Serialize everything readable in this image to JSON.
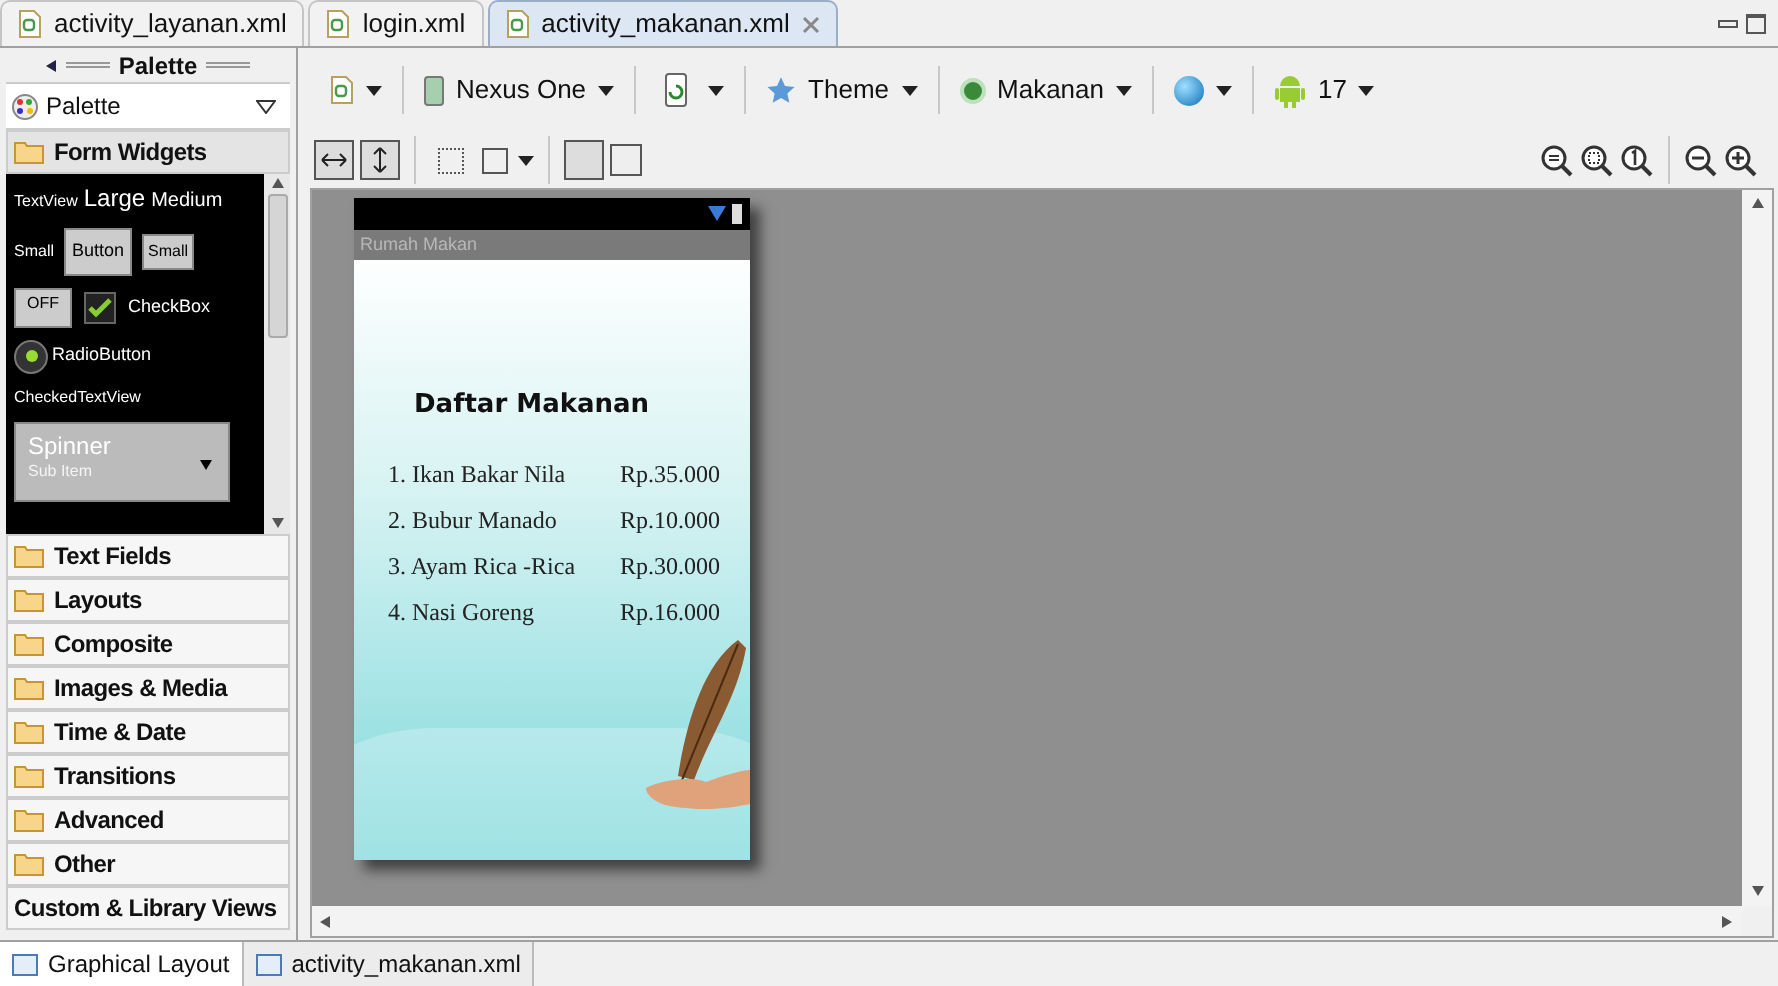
{
  "editor_tabs": [
    {
      "label": "activity_layanan.xml",
      "selected": false
    },
    {
      "label": "login.xml",
      "selected": false
    },
    {
      "label": "activity_makanan.xml",
      "selected": true
    }
  ],
  "palette": {
    "title": "Palette",
    "dropdown": "Palette",
    "sections": [
      {
        "label": "Form Widgets",
        "kind": "folder",
        "expanded": true
      },
      {
        "label": "Text Fields",
        "kind": "folder",
        "expanded": false
      },
      {
        "label": "Layouts",
        "kind": "folder",
        "expanded": false
      },
      {
        "label": "Composite",
        "kind": "folder",
        "expanded": false
      },
      {
        "label": "Images & Media",
        "kind": "folder",
        "expanded": false
      },
      {
        "label": "Time & Date",
        "kind": "folder",
        "expanded": false
      },
      {
        "label": "Transitions",
        "kind": "folder",
        "expanded": false
      },
      {
        "label": "Advanced",
        "kind": "folder",
        "expanded": false
      },
      {
        "label": "Other",
        "kind": "folder",
        "expanded": false
      },
      {
        "label": "Custom & Library Views",
        "kind": "plain",
        "expanded": false
      }
    ],
    "widgets": {
      "textview": "TextView",
      "large": "Large",
      "medium": "Medium",
      "small_text": "Small",
      "button": "Button",
      "small_button": "Small",
      "toggle": "OFF",
      "checkbox": {
        "label": "CheckBox",
        "checked": true
      },
      "radio": {
        "label": "RadioButton",
        "selected": true
      },
      "checked_text_view": "CheckedTextView",
      "spinner": "Spinner",
      "spinner_sub": "Sub Item"
    }
  },
  "toolbar": {
    "device": "Nexus One",
    "theme": "Theme",
    "activity": "Makanan",
    "api": "17"
  },
  "phone": {
    "app_title": "Rumah Makan",
    "heading": "Daftar Makanan",
    "menu": [
      {
        "name": "1. Ikan Bakar Nila",
        "price": "Rp.35.000"
      },
      {
        "name": "2. Bubur Manado",
        "price": "Rp.10.000"
      },
      {
        "name": "3. Ayam Rica -Rica",
        "price": "Rp.30.000"
      },
      {
        "name": "4. Nasi Goreng",
        "price": "Rp.16.000"
      }
    ]
  },
  "bottom_tabs": [
    {
      "label": "Graphical Layout",
      "selected": true
    },
    {
      "label": "activity_makanan.xml",
      "selected": false
    }
  ]
}
